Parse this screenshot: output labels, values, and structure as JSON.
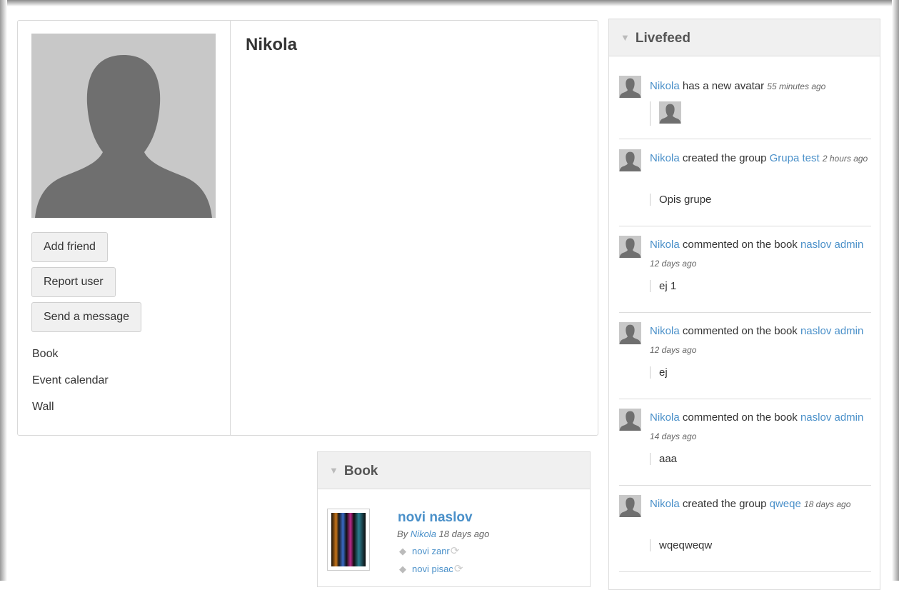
{
  "profile": {
    "name": "Nikola",
    "buttons": {
      "add_friend": "Add friend",
      "report_user": "Report user",
      "send_message": "Send a message"
    },
    "links": [
      "Book",
      "Event calendar",
      "Wall"
    ]
  },
  "book_widget": {
    "title": "Book",
    "book": {
      "title": "novi naslov",
      "by_prefix": "By",
      "author": "Nikola",
      "time": "18 days ago",
      "tags": [
        "novi zanr",
        "novi pisac"
      ]
    }
  },
  "livefeed": {
    "title": "Livefeed",
    "items": [
      {
        "user": "Nikola",
        "action": "has a new avatar",
        "object": "",
        "time": "55 minutes ago",
        "content": ""
      },
      {
        "user": "Nikola",
        "action": "created the group",
        "object": "Grupa test",
        "time": "2 hours ago",
        "content": "Opis grupe"
      },
      {
        "user": "Nikola",
        "action": "commented on the book",
        "object": "naslov admin",
        "time": "12 days ago",
        "content": "ej 1"
      },
      {
        "user": "Nikola",
        "action": "commented on the book",
        "object": "naslov admin",
        "time": "12 days ago",
        "content": "ej"
      },
      {
        "user": "Nikola",
        "action": "commented on the book",
        "object": "naslov admin",
        "time": "14 days ago",
        "content": "aaa"
      },
      {
        "user": "Nikola",
        "action": "created the group",
        "object": "qweqe",
        "time": "18 days ago",
        "content": "wqeqweqw"
      }
    ]
  },
  "colors": {
    "link": "#4a90c9",
    "header_bg": "#f0f0f0",
    "avatar_bg": "#c8c8c8",
    "silhouette": "#6f6f6f"
  },
  "icons": [
    "collapse-triangle-icon",
    "user-silhouette-icon",
    "tag-icon",
    "refresh-icon"
  ]
}
